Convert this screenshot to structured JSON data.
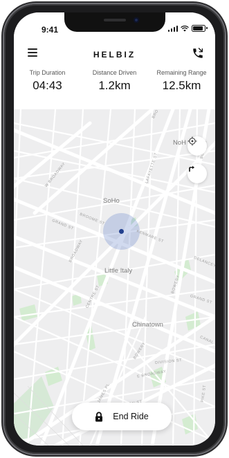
{
  "status_bar": {
    "time": "9:41"
  },
  "app": {
    "brand": "HELBIZ"
  },
  "trip_stats": [
    {
      "label": "Trip Duration",
      "value": "04:43"
    },
    {
      "label": "Distance Driven",
      "value": "1.2km"
    },
    {
      "label": "Remaining Range",
      "value": "12.5km"
    }
  ],
  "map": {
    "districts": [
      "SoHo",
      "Little Italy",
      "Chinatown",
      "NoH"
    ],
    "streets": [
      "W BROADWAY",
      "BROOME ST",
      "GRAND ST",
      "BROADWAY",
      "KENMARE ST",
      "LAFAYETTE ST",
      "DELANCEY",
      "BOWERY",
      "CENTRE ST",
      "GRAND ST",
      "CANAL S",
      "DIVISION ST",
      "E BROADWAY",
      "BOWERY",
      "T JAMES PL",
      "MADISON ST",
      "PIKE ST",
      "BOWERY",
      "BRO"
    ]
  },
  "actions": {
    "end_ride_label": "End Ride"
  },
  "colors": {
    "location_dot": "#23408e",
    "location_halo": "#8aa0d6",
    "park_green": "#c9e6c8",
    "water_blue": "#bfe0f2"
  },
  "icons": [
    "menu-icon",
    "phone-icon",
    "locate-icon",
    "directions-icon",
    "lock-icon"
  ]
}
